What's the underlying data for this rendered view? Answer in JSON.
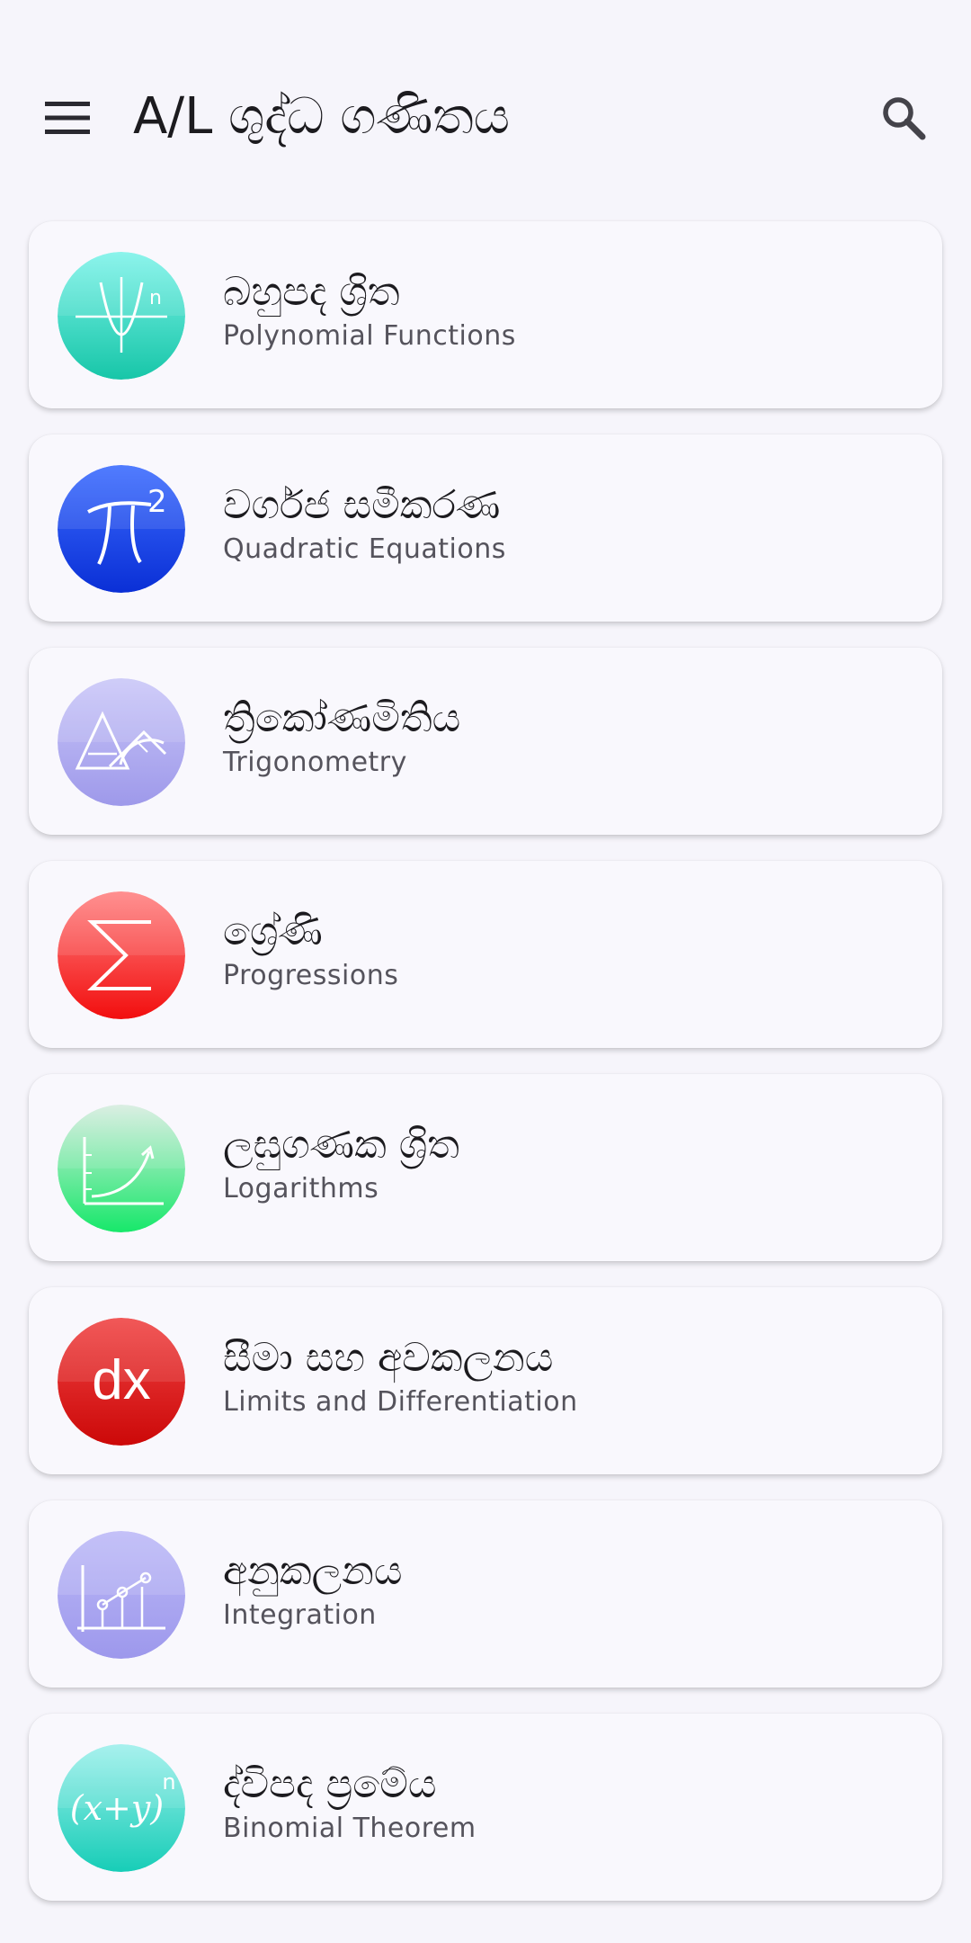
{
  "app_bar": {
    "title": "A/L ශුද්ධ ගණිතය",
    "menu_icon": "menu-icon",
    "search_icon": "search-icon"
  },
  "topics": [
    {
      "si": "බහුපද ශ්‍රිත",
      "en": "Polynomial Functions",
      "icon": "parabola-icon",
      "colors": [
        "#7ff3ea",
        "#17c6a8"
      ]
    },
    {
      "si": "වර්ගජ සමීකරණ",
      "en": "Quadratic Equations",
      "icon": "pi-squared-icon",
      "colors": [
        "#3d6dff",
        "#0a2fd6"
      ]
    },
    {
      "si": "ත්‍රිකෝණමිතිය",
      "en": "Trigonometry",
      "icon": "protractor-triangle-icon",
      "colors": [
        "#c9c6f8",
        "#9e99ea"
      ]
    },
    {
      "si": "ශ්‍රේණි",
      "en": "Progressions",
      "icon": "sigma-icon",
      "colors": [
        "#ff8484",
        "#f20e0e"
      ]
    },
    {
      "si": "ලඝුගණක ශ්‍රිත",
      "en": "Logarithms",
      "icon": "exponential-curve-icon",
      "colors": [
        "#d7ece0",
        "#17e86a"
      ]
    },
    {
      "si": "සීමා සහ අවකලනය",
      "en": "Limits and Differentiation",
      "icon": "dx-icon",
      "colors": [
        "#f04545",
        "#cc0808"
      ]
    },
    {
      "si": "අනුකලනය",
      "en": "Integration",
      "icon": "bar-graph-icon",
      "colors": [
        "#bcb9f7",
        "#9d98ec"
      ]
    },
    {
      "si": "ද්විපද ප්‍රමේය",
      "en": "Binomial Theorem",
      "icon": "binomial-power-icon",
      "colors": [
        "#9ef0ec",
        "#17cdb7"
      ]
    }
  ],
  "badge_glyphs": {
    "pi_squared": "2",
    "dx": "dx",
    "binomial": "(x+y)",
    "binomial_exp": "n",
    "poly_exp": "n"
  }
}
